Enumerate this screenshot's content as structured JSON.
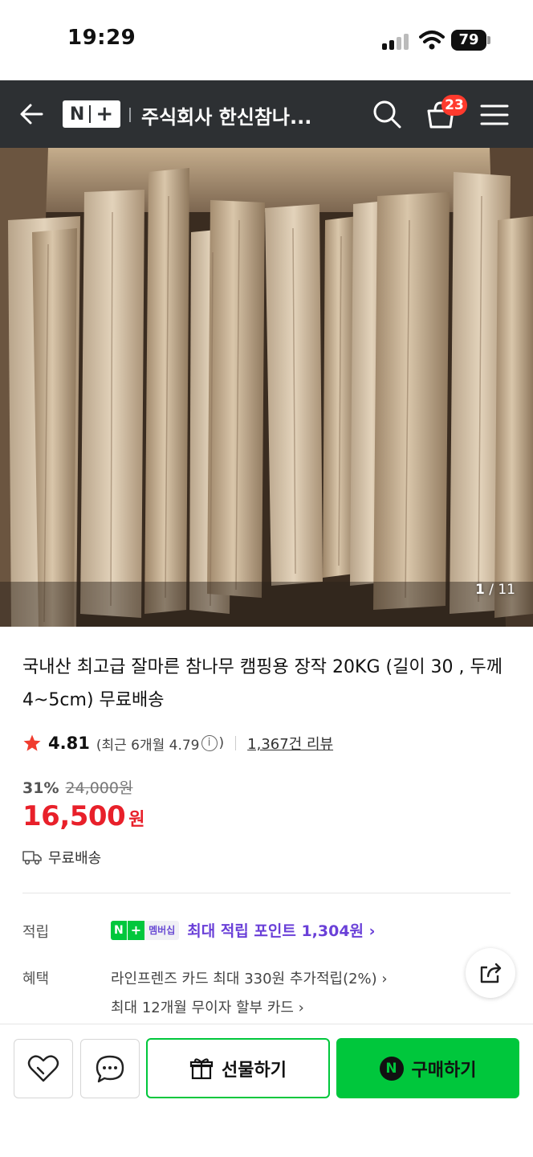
{
  "status_bar": {
    "time": "19:29",
    "battery": "79"
  },
  "header": {
    "title": "주식회사 한신참나...",
    "cart_count": "23"
  },
  "gallery": {
    "current": "1",
    "total": "/ 11"
  },
  "product": {
    "title": "국내산 최고급 잘마른 참나무 캠핑용 장작 20KG (길이 30 , 두께 4~5cm) 무료배송",
    "rating": "4.81",
    "recent_rating_prefix": "(최근 6개월 4.79",
    "recent_rating_suffix": ")",
    "info_glyph": "i",
    "review_link": "1,367건 리뷰",
    "discount_rate": "31%",
    "original_price": "24,000원",
    "price": "16,500",
    "price_unit": "원",
    "shipping": "무료배송"
  },
  "points": {
    "label": "적립",
    "badge_n": "N",
    "badge_plus": "+",
    "badge_membership": "멤버십",
    "text": "최대 적립 포인트 1,304원 ›"
  },
  "benefits": {
    "label": "혜택",
    "line1": "라인프렌즈 카드 최대 330원 추가적립(2%) ›",
    "line2": "최대 12개월 무이자 할부 카드 ›"
  },
  "bottom_bar": {
    "gift_label": "선물하기",
    "buy_label": "구매하기",
    "npay_glyph": "N"
  },
  "colors": {
    "header_bg": "#2d3033",
    "price_red": "#e8202a",
    "naver_green": "#00c73c",
    "points_purple": "#6a40d8",
    "badge_red": "#ff3a2d"
  },
  "icons": [
    "back-arrow-icon",
    "search-icon",
    "cart-icon",
    "menu-icon",
    "star-icon",
    "info-icon",
    "truck-icon",
    "share-icon",
    "heart-icon",
    "chat-icon",
    "gift-icon",
    "npay-icon"
  ]
}
